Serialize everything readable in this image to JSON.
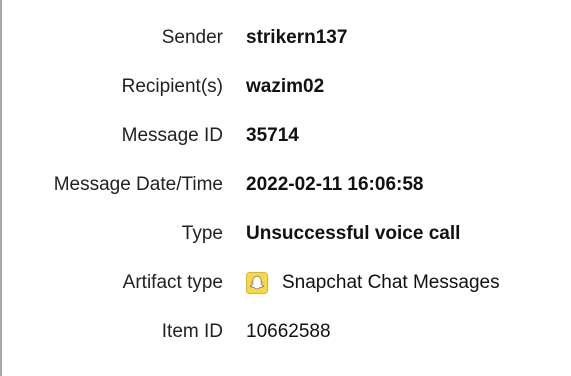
{
  "fields": [
    {
      "label": "Sender",
      "value": "strikern137"
    },
    {
      "label": "Recipient(s)",
      "value": "wazim02"
    },
    {
      "label": "Message ID",
      "value": "35714"
    },
    {
      "label": "Message Date/Time",
      "value": "2022-02-11 16:06:58"
    },
    {
      "label": "Type",
      "value": "Unsuccessful voice call"
    },
    {
      "label": "Artifact type",
      "value": "Snapchat Chat Messages",
      "icon": "snapchat-icon"
    },
    {
      "label": "Item ID",
      "value": "10662588"
    }
  ],
  "colors": {
    "snapchat_yellow": "#F7D84A",
    "border": "#a9a9a9"
  }
}
